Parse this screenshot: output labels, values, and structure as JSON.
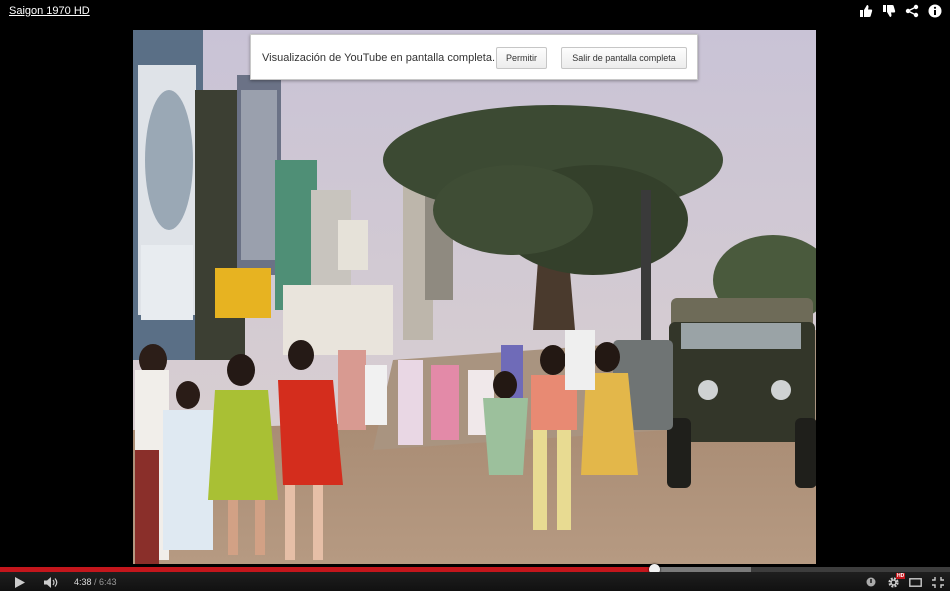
{
  "header": {
    "title": "Saigon 1970 HD",
    "icons": [
      "thumbs-up-icon",
      "thumbs-down-icon",
      "share-icon",
      "info-icon"
    ]
  },
  "notice": {
    "message": "Visualización de YouTube en pantalla completa.",
    "allow_label": "Permitir",
    "exit_label": "Salir de pantalla completa"
  },
  "player": {
    "current_time": "4:38",
    "separator": " / ",
    "duration": "6:43",
    "played_fraction": 0.688,
    "buffered_fraction": 0.79,
    "hd_badge": "HD",
    "colors": {
      "progress_played": "#c4161c",
      "progress_buffered": "#7a7a7a"
    }
  }
}
